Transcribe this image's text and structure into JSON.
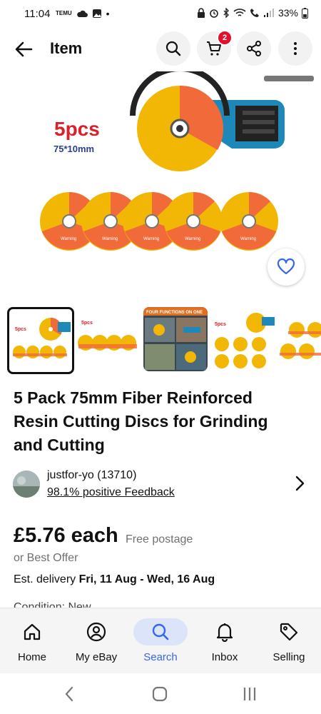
{
  "status_bar": {
    "time": "11:04",
    "battery": "33%",
    "temu_label": "TEMU"
  },
  "app_bar": {
    "title": "Item",
    "cart_count": "2"
  },
  "hero_image": {
    "pack_label": "5pcs",
    "size_label": "75*10mm",
    "disc_text": "Warning"
  },
  "thumbnails": [
    {
      "label": "5pcs"
    },
    {
      "label": "5pcs"
    },
    {
      "label": "FOUR FUNCTIONS ON ONE"
    },
    {
      "label": "5pcs"
    },
    {
      "label": ""
    }
  ],
  "product": {
    "title": "5 Pack 75mm Fiber Reinforced Resin Cutting Discs for Grinding and Cutting"
  },
  "seller": {
    "name": "justfor-yo (13710)",
    "feedback": "98.1% positive Feedback"
  },
  "pricing": {
    "price": "£5.76 each",
    "postage": "Free postage",
    "offer": "or Best Offer",
    "delivery_label": "Est. delivery",
    "delivery_dates": "Fri, 11 Aug - Wed, 16 Aug",
    "condition_partial": "Condition: New"
  },
  "bottom_nav": [
    {
      "label": "Home",
      "icon": "home-icon"
    },
    {
      "label": "My eBay",
      "icon": "user-icon"
    },
    {
      "label": "Search",
      "icon": "search-icon"
    },
    {
      "label": "Inbox",
      "icon": "bell-icon"
    },
    {
      "label": "Selling",
      "icon": "tag-icon"
    }
  ],
  "colors": {
    "accent": "#3665f3",
    "badge": "#e0112a",
    "disc_yellow": "#f2b705",
    "disc_orange": "#f06a3a"
  }
}
